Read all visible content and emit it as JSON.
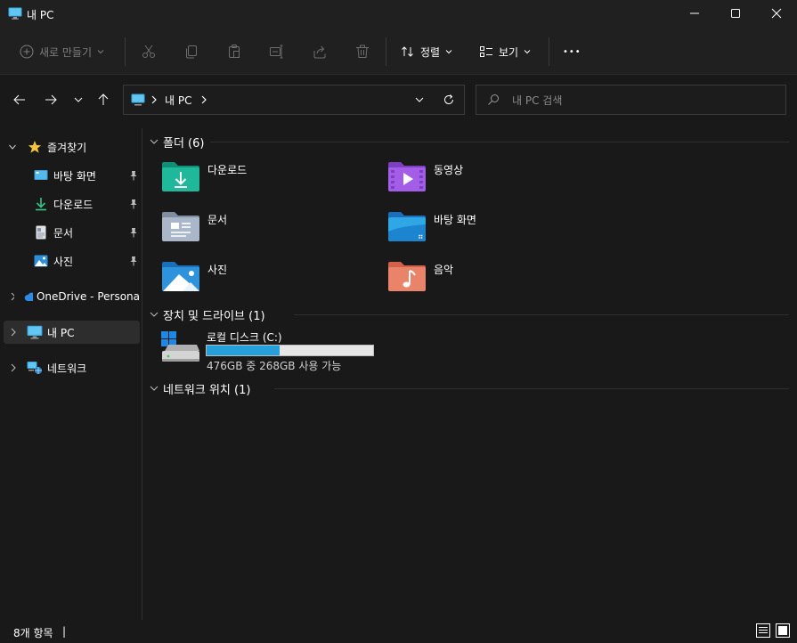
{
  "window": {
    "title": "내 PC"
  },
  "toolbar": {
    "new_label": "새로 만들기",
    "sort_label": "정렬",
    "view_label": "보기",
    "more_label": "•••"
  },
  "address": {
    "crumb": "내 PC",
    "search_placeholder": "내 PC 검색"
  },
  "sidebar": {
    "favorites_label": "즐겨찾기",
    "quick": [
      {
        "label": "바탕 화면",
        "icon": "desktop-icon"
      },
      {
        "label": "다운로드",
        "icon": "download-icon"
      },
      {
        "label": "문서",
        "icon": "document-icon"
      },
      {
        "label": "사진",
        "icon": "pictures-icon"
      }
    ],
    "onedrive_label": "OneDrive - Persona",
    "thispc_label": "내 PC",
    "network_label": "네트워크"
  },
  "content": {
    "folders_header": "폴더 (6)",
    "folders": [
      {
        "label": "다운로드",
        "icon": "downloads-folder-icon"
      },
      {
        "label": "동영상",
        "icon": "videos-folder-icon"
      },
      {
        "label": "문서",
        "icon": "documents-folder-icon"
      },
      {
        "label": "바탕 화면",
        "icon": "desktop-folder-icon"
      },
      {
        "label": "사진",
        "icon": "pictures-folder-icon"
      },
      {
        "label": "음악",
        "icon": "music-folder-icon"
      }
    ],
    "devices_header": "장치 및 드라이브 (1)",
    "drive": {
      "label": "로컬 디스크 (C:)",
      "space": "476GB 중 268GB 사용 가능",
      "used_fraction": 0.437
    },
    "network_header": "네트워크 위치 (1)"
  },
  "status": {
    "count": "8개 항목",
    "cursor": "|"
  },
  "colors": {
    "accent": "#4cc2ff",
    "drive_bar": "#26a0da",
    "drive_bar_bg": "#e6e6e6"
  }
}
